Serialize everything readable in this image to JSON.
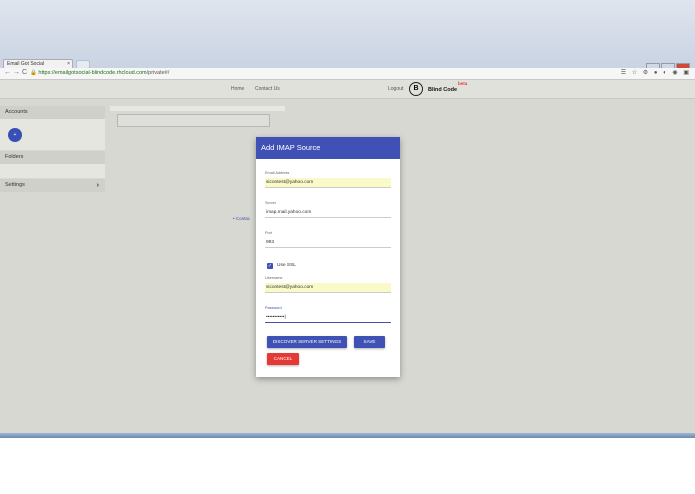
{
  "browser": {
    "tab_title": "Email Got Social",
    "tab_close": "×",
    "url_secure": "https://emailgotsocial-blindcode.rhcloud.com",
    "url_path": "/private#/",
    "back": "←",
    "forward": "→",
    "reload": "C",
    "extensions": "☰ ☆ ⚙ ● ◐ ◉ ▣"
  },
  "header": {
    "nav": [
      "Home",
      "Contact Us"
    ],
    "logout": "Logout",
    "logo_mark": "B",
    "logo_text": "Blind Code",
    "beta": "beta"
  },
  "sidebar": {
    "accounts": "Accounts",
    "add_button": "+",
    "folders": "Folders",
    "settings": "Settings",
    "settings_chevron": "›"
  },
  "main": {
    "contact_link": "• Contac"
  },
  "modal": {
    "title": "Add IMAP Source",
    "email_label": "Email Address",
    "email_value": "sicontest@yahoo.com",
    "server_label": "Server",
    "server_value": "imap.mail.yahoo.com",
    "port_label": "Port",
    "port_value": "993",
    "ssl_label": "Use SSL",
    "ssl_checked": true,
    "username_label": "Username",
    "username_value": "sicontest@yahoo.com",
    "password_label": "Password",
    "password_value": "•••••••••••|",
    "discover_button": "DISCOVER SERVER SETTINGS",
    "save_button": "SAVE",
    "cancel_button": "CANCEL"
  },
  "colors": {
    "primary": "#3f51b5",
    "cancel": "#e53935",
    "autofill": "#fafac8"
  }
}
